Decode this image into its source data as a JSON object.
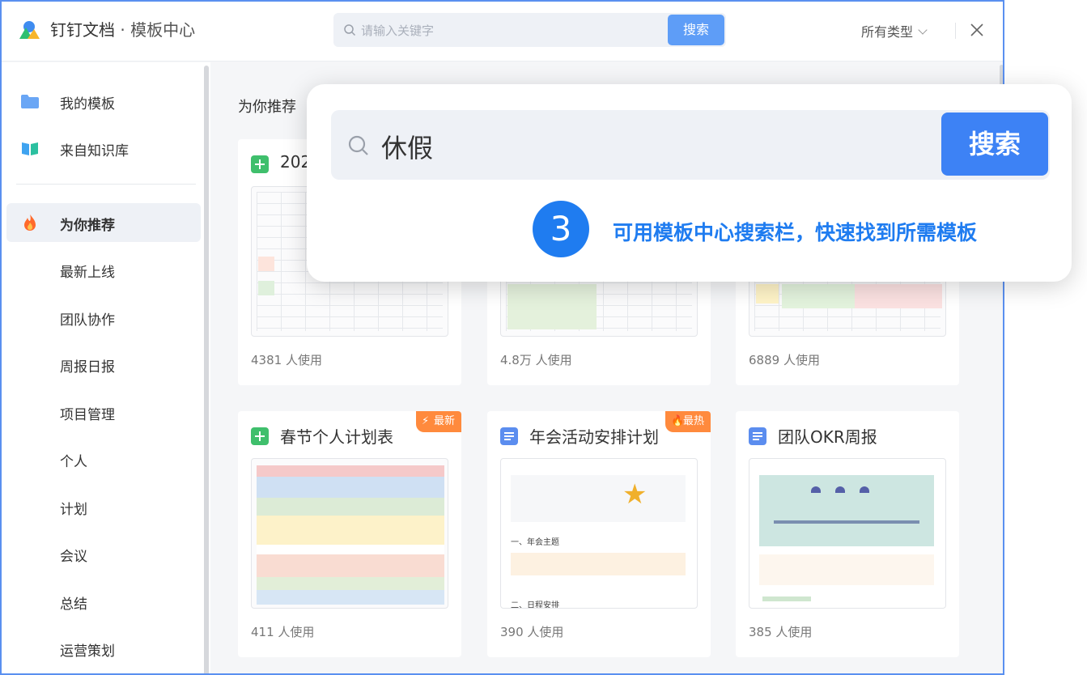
{
  "app": {
    "name": "钉钉文档",
    "separator": " · ",
    "section": "模板中心"
  },
  "search": {
    "placeholder": "请输入关键字",
    "button": "搜索"
  },
  "filter": {
    "label": "所有类型"
  },
  "sidebar": {
    "top_items": [
      {
        "label": "我的模板",
        "icon": "folder-icon"
      },
      {
        "label": "来自知识库",
        "icon": "book-icon"
      }
    ],
    "categories": [
      {
        "label": "为你推荐",
        "icon": "fire-icon",
        "active": true
      },
      {
        "label": "最新上线"
      },
      {
        "label": "团队协作"
      },
      {
        "label": "周报日报"
      },
      {
        "label": "项目管理"
      },
      {
        "label": "个人"
      },
      {
        "label": "计划"
      },
      {
        "label": "会议"
      },
      {
        "label": "总结"
      },
      {
        "label": "运营策划"
      }
    ]
  },
  "main": {
    "section_title": "为你推荐",
    "cards": [
      {
        "title": "202",
        "icon": "sheet-icon",
        "uses": "4381 人使用"
      },
      {
        "title": "",
        "icon": "sheet-icon",
        "uses": "4.8万 人使用"
      },
      {
        "title": "",
        "icon": "sheet-icon",
        "uses": "6889 人使用"
      },
      {
        "title": "春节个人计划表",
        "icon": "sheet-icon",
        "uses": "411 人使用",
        "badge": "最新",
        "badge_icon": "lightning-icon"
      },
      {
        "title": "年会活动安排计划",
        "icon": "doc-icon",
        "uses": "390 人使用",
        "badge": "最热",
        "badge_icon": "fire-icon"
      },
      {
        "title": "团队OKR周报",
        "icon": "doc-icon",
        "uses": "385 人使用"
      }
    ],
    "thumb_text": {
      "annual_meeting_theme": "一、年会主题",
      "schedule": "二、日程安排"
    }
  },
  "popup": {
    "search_value": "休假",
    "search_button": "搜索",
    "step_number": "3",
    "hint": "可用模板中心搜索栏，快速找到所需模板"
  },
  "colors": {
    "accent": "#3d82f5",
    "hint": "#1f7cf0",
    "badge": "#ff8a3d",
    "window_border": "#5a90f0"
  }
}
